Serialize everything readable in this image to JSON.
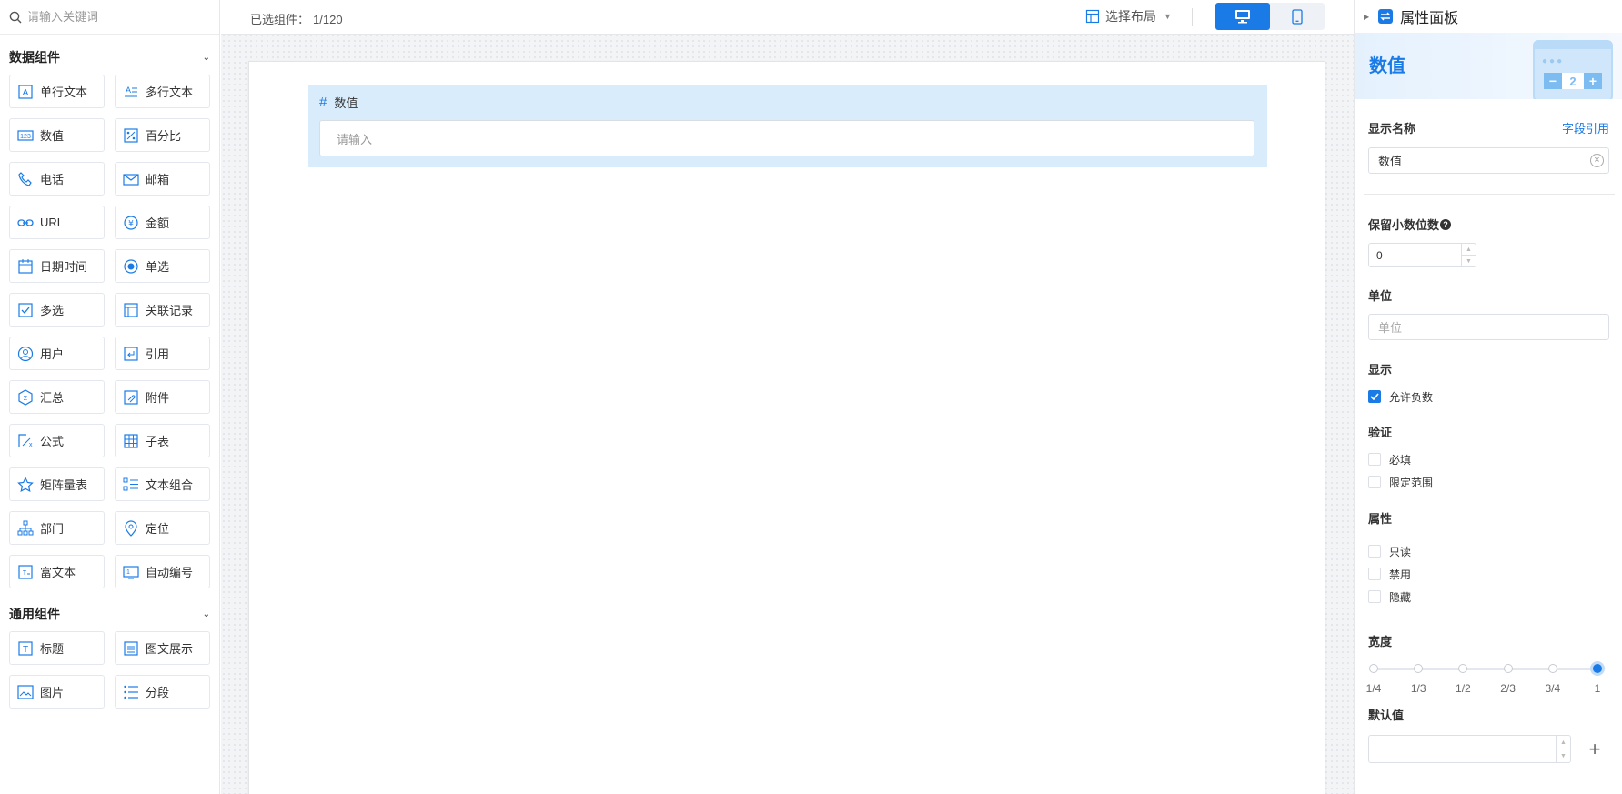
{
  "search": {
    "placeholder": "请输入关键词"
  },
  "groups": [
    {
      "title": "数据组件",
      "items": [
        {
          "label": "单行文本",
          "icon": "single-line-text-icon"
        },
        {
          "label": "多行文本",
          "icon": "multi-line-text-icon"
        },
        {
          "label": "数值",
          "icon": "number-icon"
        },
        {
          "label": "百分比",
          "icon": "percent-icon"
        },
        {
          "label": "电话",
          "icon": "phone-icon"
        },
        {
          "label": "邮箱",
          "icon": "email-icon"
        },
        {
          "label": "URL",
          "icon": "link-icon"
        },
        {
          "label": "金额",
          "icon": "currency-icon"
        },
        {
          "label": "日期时间",
          "icon": "calendar-icon"
        },
        {
          "label": "单选",
          "icon": "radio-icon"
        },
        {
          "label": "多选",
          "icon": "checkbox-icon"
        },
        {
          "label": "关联记录",
          "icon": "related-record-icon"
        },
        {
          "label": "用户",
          "icon": "user-icon"
        },
        {
          "label": "引用",
          "icon": "reference-icon"
        },
        {
          "label": "汇总",
          "icon": "summary-icon"
        },
        {
          "label": "附件",
          "icon": "attachment-icon"
        },
        {
          "label": "公式",
          "icon": "formula-icon"
        },
        {
          "label": "子表",
          "icon": "subtable-icon"
        },
        {
          "label": "矩阵量表",
          "icon": "star-icon"
        },
        {
          "label": "文本组合",
          "icon": "text-combo-icon"
        },
        {
          "label": "部门",
          "icon": "org-chart-icon"
        },
        {
          "label": "定位",
          "icon": "location-pin-icon"
        },
        {
          "label": "富文本",
          "icon": "rich-text-icon"
        },
        {
          "label": "自动编号",
          "icon": "auto-number-icon"
        }
      ]
    },
    {
      "title": "通用组件",
      "items": [
        {
          "label": "标题",
          "icon": "title-icon"
        },
        {
          "label": "图文展示",
          "icon": "image-text-icon"
        },
        {
          "label": "图片",
          "icon": "image-icon"
        },
        {
          "label": "分段",
          "icon": "section-icon"
        }
      ]
    }
  ],
  "toolbar": {
    "selected_label": "已选组件：",
    "selected_count": "1/120",
    "layout_label": "选择布局",
    "device_active": "desktop"
  },
  "canvas": {
    "field_label": "数值",
    "field_placeholder": "请输入"
  },
  "panel": {
    "title": "属性面板",
    "banner_title": "数值",
    "banner_stepper_value": "2",
    "display_name_label": "显示名称",
    "field_ref_link": "字段引用",
    "display_name_value": "数值",
    "decimals_label": "保留小数位数",
    "decimals_value": "0",
    "unit_label": "单位",
    "unit_placeholder": "单位",
    "display_label": "显示",
    "allow_negative_label": "允许负数",
    "allow_negative_checked": true,
    "validation_label": "验证",
    "required_label": "必填",
    "range_label": "限定范围",
    "attrs_label": "属性",
    "readonly_label": "只读",
    "disabled_label": "禁用",
    "hidden_label": "隐藏",
    "width_label": "宽度",
    "width_options": [
      "1/4",
      "1/3",
      "1/2",
      "2/3",
      "3/4",
      "1"
    ],
    "width_selected": "1",
    "default_label": "默认值",
    "accent_color": "#1a7be6"
  }
}
